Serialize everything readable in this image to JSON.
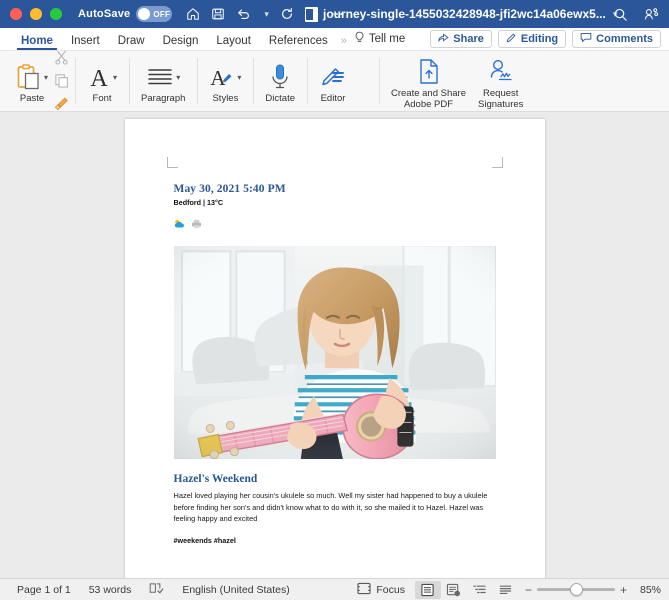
{
  "titlebar": {
    "autosave_label": "AutoSave",
    "autosave_state": "OFF",
    "document_title": "journey-single-1455032428948-jfi2wc14a06ewx5...",
    "icons": [
      "home-icon",
      "save-icon",
      "undo-icon",
      "redo-icon",
      "print-icon",
      "more-icon",
      "search-icon",
      "share-user-icon"
    ],
    "accent_color": "#2b579a"
  },
  "ribbon_tabs": {
    "items": [
      {
        "label": "Home",
        "active": true
      },
      {
        "label": "Insert",
        "active": false
      },
      {
        "label": "Draw",
        "active": false
      },
      {
        "label": "Design",
        "active": false
      },
      {
        "label": "Layout",
        "active": false
      },
      {
        "label": "References",
        "active": false
      }
    ],
    "overflow": "»",
    "tell_me": "Tell me",
    "share": "Share",
    "editing": "Editing",
    "comments": "Comments"
  },
  "ribbon": {
    "groups": [
      {
        "name": "clipboard",
        "commands": [
          {
            "label": "Paste",
            "icon": "paste-icon",
            "has_caret": true
          }
        ]
      },
      {
        "name": "font",
        "commands": [
          {
            "label": "Font",
            "icon": "font-icon",
            "has_caret": true
          }
        ]
      },
      {
        "name": "paragraph",
        "commands": [
          {
            "label": "Paragraph",
            "icon": "paragraph-icon",
            "has_caret": true
          }
        ]
      },
      {
        "name": "styles",
        "commands": [
          {
            "label": "Styles",
            "icon": "styles-icon",
            "has_caret": true
          }
        ]
      },
      {
        "name": "dictate",
        "commands": [
          {
            "label": "Dictate",
            "icon": "microphone-icon",
            "has_caret": false
          }
        ]
      },
      {
        "name": "editor",
        "commands": [
          {
            "label": "Editor",
            "icon": "editor-pen-icon",
            "has_caret": false
          }
        ]
      },
      {
        "name": "adobe",
        "commands": [
          {
            "label": "Create and Share\nAdobe PDF",
            "icon": "pdf-upload-icon",
            "has_caret": false
          },
          {
            "label": "Request\nSignatures",
            "icon": "signature-icon",
            "has_caret": false
          }
        ]
      }
    ],
    "labels": {
      "paste": "Paste",
      "font": "Font",
      "paragraph": "Paragraph",
      "styles": "Styles",
      "dictate": "Dictate",
      "editor": "Editor",
      "create_share_pdf_l1": "Create and Share",
      "create_share_pdf_l2": "Adobe PDF",
      "request_sig_l1": "Request",
      "request_sig_l2": "Signatures"
    }
  },
  "document": {
    "entry_date": "May 30, 2021 5:40 PM",
    "entry_location": "Bedford | 13°C",
    "entry_icons": [
      "weather-cloud-icon",
      "printer-icon"
    ],
    "photo_alt": "girl-playing-pink-ukulele-photo",
    "entry_title": "Hazel's Weekend",
    "entry_body": "Hazel loved playing her cousin's ukulele so much. Well my sister had happened to buy a ukulele before finding her son's and didn't know what to do with it, so she mailed it to Hazel. Hazel was feeling happy and excited",
    "entry_tags": "#weekends #hazel",
    "heading_color": "#2b5797"
  },
  "statusbar": {
    "page": "Page 1 of 1",
    "words": "53 words",
    "proofing_icon": "proofing-check-icon",
    "language": "English (United States)",
    "focus": "Focus",
    "views": [
      {
        "name": "print-layout",
        "selected": true
      },
      {
        "name": "web-layout",
        "selected": false
      },
      {
        "name": "outline",
        "selected": false
      },
      {
        "name": "draft",
        "selected": false
      }
    ],
    "zoom_out": "−",
    "zoom_in": "+",
    "zoom_level": "85%"
  }
}
